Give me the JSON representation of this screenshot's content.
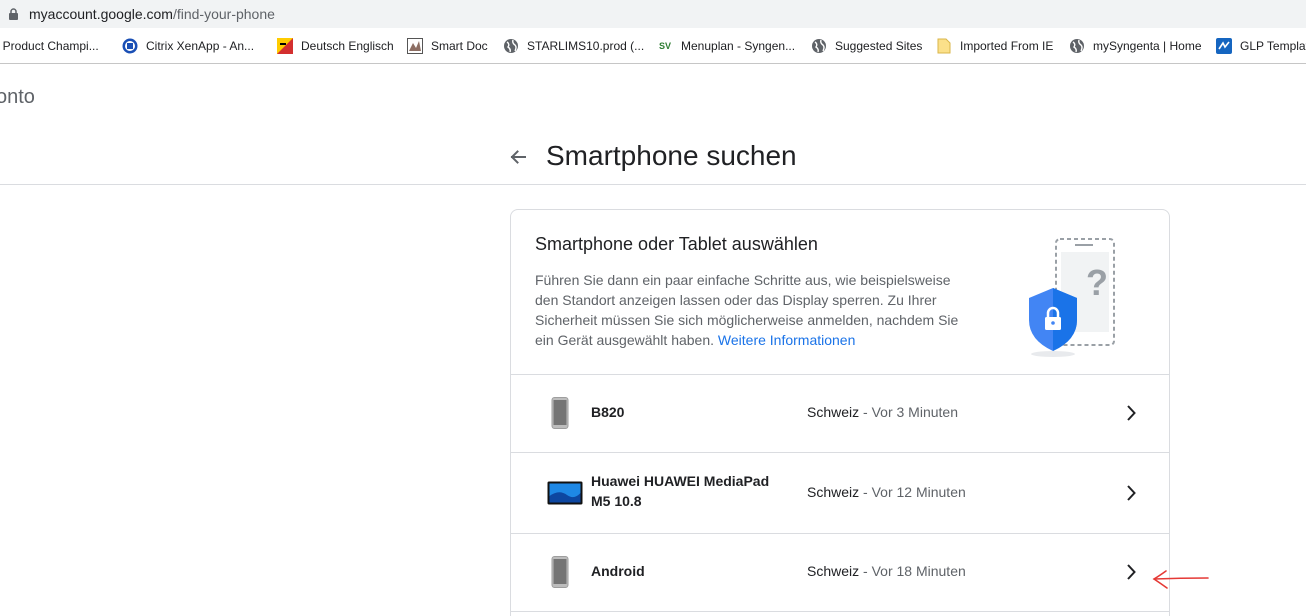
{
  "browser": {
    "url_host": "myaccount.google.com",
    "url_path": "/find-your-phone"
  },
  "bookmarks": [
    {
      "label": "I Product Champi...",
      "icon": "bookmark-icon"
    },
    {
      "label": "Citrix XenApp - An...",
      "icon": "citrix-icon"
    },
    {
      "label": "Deutsch Englisch",
      "icon": "dictionary-icon"
    },
    {
      "label": "Smart Doc",
      "icon": "smartdoc-icon"
    },
    {
      "label": "STARLIMS10.prod (...",
      "icon": "globe-icon"
    },
    {
      "label": "Menuplan - Syngen...",
      "icon": "sv-icon",
      "icon_text": "SV"
    },
    {
      "label": "Suggested Sites",
      "icon": "globe-icon"
    },
    {
      "label": "Imported From IE",
      "icon": "folder-icon"
    },
    {
      "label": "mySyngenta | Home",
      "icon": "globe-icon"
    },
    {
      "label": "GLP Templat",
      "icon": "glp-icon"
    }
  ],
  "account": {
    "title": "onto"
  },
  "page": {
    "title": "Smartphone suchen"
  },
  "card": {
    "title": "Smartphone oder Tablet auswählen",
    "description": "Führen Sie dann ein paar einfache Schritte aus, wie beispielsweise den Standort anzeigen lassen oder das Display sperren. Zu Ihrer Sicherheit müssen Sie sich möglicherweise anmelden, nachdem Sie ein Gerät ausgewählt haben.",
    "learn_more": "Weitere Informationen",
    "illustration_mark": "?"
  },
  "devices": [
    {
      "name": "B820",
      "type": "phone",
      "location": "Schweiz",
      "separator": " - ",
      "last_seen": "Vor 3 Minuten"
    },
    {
      "name": "Huawei HUAWEI MediaPad M5 10.8",
      "type": "tablet",
      "location": "Schweiz",
      "separator": " - ",
      "last_seen": "Vor 12 Minuten"
    },
    {
      "name": "Android",
      "type": "phone",
      "location": "Schweiz",
      "separator": " - ",
      "last_seen": "Vor 18 Minuten"
    }
  ],
  "colors": {
    "accent": "#1a73e8",
    "annotation": "#e53935",
    "shield": "#4285f4"
  }
}
